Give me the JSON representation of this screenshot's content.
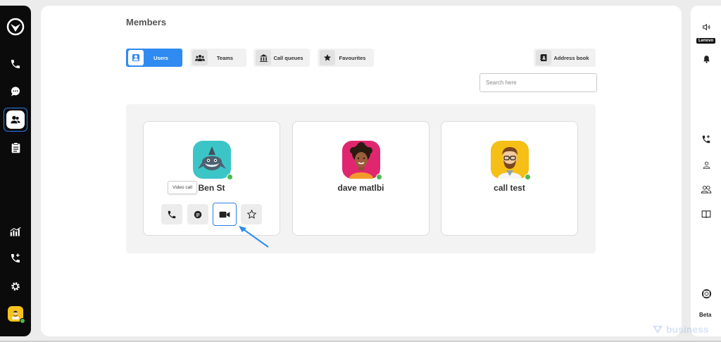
{
  "page": {
    "title": "Members"
  },
  "tabs": [
    {
      "label": "Users",
      "icon": "user-icon",
      "active": true
    },
    {
      "label": "Teams",
      "icon": "team-icon",
      "active": false
    },
    {
      "label": "Call queues",
      "icon": "call-queue-icon",
      "active": false
    },
    {
      "label": "Favourites",
      "icon": "star-icon",
      "active": false
    }
  ],
  "address_book": {
    "label": "Address book"
  },
  "search": {
    "placeholder": "Search here"
  },
  "members": [
    {
      "name": "Ben St",
      "avatar_color": "#3cc5c7",
      "status": "online"
    },
    {
      "name": "dave matlbi",
      "avatar_color": "#e0266f",
      "status": "online"
    },
    {
      "name": "call test",
      "avatar_color": "#f5bf16",
      "status": "online"
    }
  ],
  "actions": {
    "call": "phone-icon",
    "message": "chat-icon",
    "video": "video-camera-icon",
    "favourite": "star-outline-icon"
  },
  "tooltip": {
    "text": "Video call"
  },
  "right_bar": {
    "device_label": "Lenovo",
    "beta_label": "Beta"
  },
  "brand": {
    "watermark": "business",
    "accent": "#2f8bf1",
    "status_green": "#4cbb4f"
  }
}
